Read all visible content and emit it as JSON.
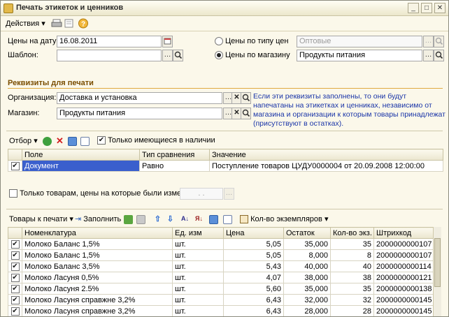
{
  "window": {
    "title": "Печать этикеток и ценников"
  },
  "toolbar": {
    "actions_label": "Действия",
    "actions_arrow": "▾",
    "help_glyph": "?"
  },
  "form": {
    "price_date_label": "Цены на дату:",
    "price_date_value": "16.08.2011",
    "template_label": "Шаблон:",
    "template_value": "",
    "by_price_type_label": "Цены по типу цен",
    "price_type_value": "Оптовые",
    "by_store_label": "Цены по магазину",
    "store_value": "Продукты питания"
  },
  "requisites": {
    "section_title": "Реквизиты для печати",
    "org_label": "Организация:",
    "org_value": "Доставка и установка",
    "store_label": "Магазин:",
    "store_value": "Продукты питания",
    "info": "Если эти реквизиты заполнены, то они будут напечатаны на этикетках и ценниках, независимо от магазина и организации к которым товары принадлежат (присутствуют в остатках)."
  },
  "filter": {
    "selection_label": "Отбор",
    "only_in_stock_label": "Только имеющиеся в наличии",
    "columns": [
      "Поле",
      "Тип сравнения",
      "Значение"
    ],
    "rows": [
      {
        "checked": "✔",
        "field": "Документ",
        "comparison": "Равно",
        "value": "Поступление товаров ЦУДУ0000004 от 20.09.2008 12:00:00"
      }
    ],
    "changed_prices_label": "Только товарам, цены на которые были изменены с",
    "changed_prices_value": ". .",
    "changed_prices_btn": "…"
  },
  "goods": {
    "to_print_label": "Товары к печати",
    "fill_label": "Заполнить",
    "copies_label": "Кол-во экземпляров",
    "columns": [
      "Номенклатура",
      "Ед. изм",
      "Цена",
      "Остаток",
      "Кол-во экз.",
      "Штрихкод"
    ],
    "rows": [
      {
        "checked": "✔",
        "name": "Молоко Баланс 1,5%",
        "unit": "шт.",
        "price": "5,05",
        "stock": "35,000",
        "copies": "35",
        "barcode": "2000000000107"
      },
      {
        "checked": "✔",
        "name": "Молоко Баланс 1,5%",
        "unit": "шт.",
        "price": "5,05",
        "stock": "8,000",
        "copies": "8",
        "barcode": "2000000000107"
      },
      {
        "checked": "✔",
        "name": "Молоко Баланс 3,5%",
        "unit": "шт.",
        "price": "5,43",
        "stock": "40,000",
        "copies": "40",
        "barcode": "2000000000114"
      },
      {
        "checked": "✔",
        "name": "Молоко Ласуня 0,5%",
        "unit": "шт.",
        "price": "4,07",
        "stock": "38,000",
        "copies": "38",
        "barcode": "2000000000121"
      },
      {
        "checked": "✔",
        "name": "Молоко Ласуня 2.5%",
        "unit": "шт.",
        "price": "5,60",
        "stock": "35,000",
        "copies": "35",
        "barcode": "2000000000138"
      },
      {
        "checked": "✔",
        "name": "Молоко Ласуня справжне 3,2%",
        "unit": "шт.",
        "price": "6,43",
        "stock": "32,000",
        "copies": "32",
        "barcode": "2000000000145"
      },
      {
        "checked": "✔",
        "name": "Молоко Ласуня справжне 3,2%",
        "unit": "шт.",
        "price": "6,43",
        "stock": "28,000",
        "copies": "28",
        "barcode": "2000000000145"
      }
    ]
  },
  "icons": {
    "dropdown": "▾",
    "select_btn": "…",
    "search_btn": "⚲",
    "clear_btn": "✕"
  }
}
